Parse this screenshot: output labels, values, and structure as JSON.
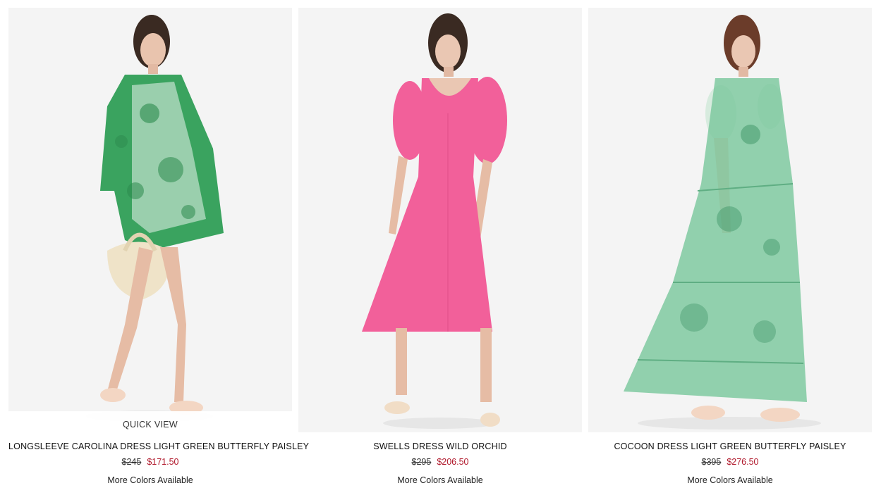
{
  "products": [
    {
      "name": "LONGSLEEVE CAROLINA DRESS LIGHT GREEN BUTTERFLY PAISLEY",
      "original_price": "$245",
      "sale_price": "$171.50",
      "colors_note": "More Colors Available",
      "quick_view": "QUICK VIEW",
      "dress_color": "#3aa35f"
    },
    {
      "name": "SWELLS DRESS WILD ORCHID",
      "original_price": "$295",
      "sale_price": "$206.50",
      "colors_note": "More Colors Available",
      "dress_color": "#f2609a"
    },
    {
      "name": "COCOON DRESS LIGHT GREEN BUTTERFLY PAISLEY",
      "original_price": "$395",
      "sale_price": "$276.50",
      "colors_note": "More Colors Available",
      "dress_color": "#7fc9a0"
    }
  ],
  "colors": {
    "sale": "#b0172a",
    "image_bg": "#f4f4f4"
  }
}
